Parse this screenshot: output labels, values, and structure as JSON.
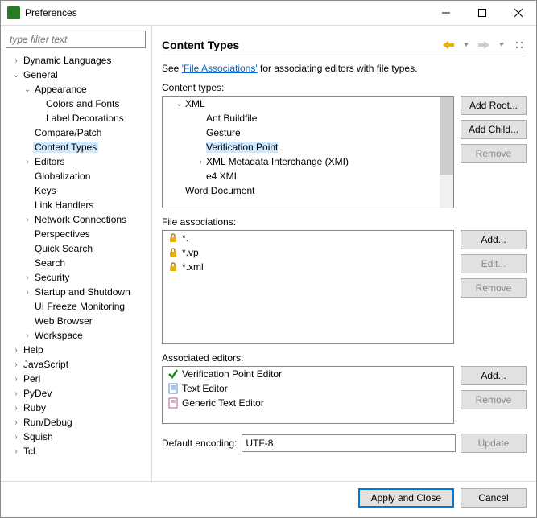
{
  "window": {
    "title": "Preferences"
  },
  "filter": {
    "placeholder": "type filter text"
  },
  "tree": [
    {
      "label": "Dynamic Languages",
      "indent": 0,
      "twisty": "›",
      "selected": false
    },
    {
      "label": "General",
      "indent": 0,
      "twisty": "⌄",
      "selected": false
    },
    {
      "label": "Appearance",
      "indent": 1,
      "twisty": "⌄",
      "selected": false
    },
    {
      "label": "Colors and Fonts",
      "indent": 2,
      "twisty": "",
      "selected": false
    },
    {
      "label": "Label Decorations",
      "indent": 2,
      "twisty": "",
      "selected": false
    },
    {
      "label": "Compare/Patch",
      "indent": 1,
      "twisty": "",
      "selected": false
    },
    {
      "label": "Content Types",
      "indent": 1,
      "twisty": "",
      "selected": true
    },
    {
      "label": "Editors",
      "indent": 1,
      "twisty": "›",
      "selected": false
    },
    {
      "label": "Globalization",
      "indent": 1,
      "twisty": "",
      "selected": false
    },
    {
      "label": "Keys",
      "indent": 1,
      "twisty": "",
      "selected": false
    },
    {
      "label": "Link Handlers",
      "indent": 1,
      "twisty": "",
      "selected": false
    },
    {
      "label": "Network Connections",
      "indent": 1,
      "twisty": "›",
      "selected": false
    },
    {
      "label": "Perspectives",
      "indent": 1,
      "twisty": "",
      "selected": false
    },
    {
      "label": "Quick Search",
      "indent": 1,
      "twisty": "",
      "selected": false
    },
    {
      "label": "Search",
      "indent": 1,
      "twisty": "",
      "selected": false
    },
    {
      "label": "Security",
      "indent": 1,
      "twisty": "›",
      "selected": false
    },
    {
      "label": "Startup and Shutdown",
      "indent": 1,
      "twisty": "›",
      "selected": false
    },
    {
      "label": "UI Freeze Monitoring",
      "indent": 1,
      "twisty": "",
      "selected": false
    },
    {
      "label": "Web Browser",
      "indent": 1,
      "twisty": "",
      "selected": false
    },
    {
      "label": "Workspace",
      "indent": 1,
      "twisty": "›",
      "selected": false
    },
    {
      "label": "Help",
      "indent": 0,
      "twisty": "›",
      "selected": false
    },
    {
      "label": "JavaScript",
      "indent": 0,
      "twisty": "›",
      "selected": false
    },
    {
      "label": "Perl",
      "indent": 0,
      "twisty": "›",
      "selected": false
    },
    {
      "label": "PyDev",
      "indent": 0,
      "twisty": "›",
      "selected": false
    },
    {
      "label": "Ruby",
      "indent": 0,
      "twisty": "›",
      "selected": false
    },
    {
      "label": "Run/Debug",
      "indent": 0,
      "twisty": "›",
      "selected": false
    },
    {
      "label": "Squish",
      "indent": 0,
      "twisty": "›",
      "selected": false
    },
    {
      "label": "Tcl",
      "indent": 0,
      "twisty": "›",
      "selected": false
    }
  ],
  "page": {
    "title": "Content Types",
    "intro_pre": "See ",
    "intro_link": "'File Associations'",
    "intro_post": " for associating editors with file types.",
    "ct_label": "Content types:",
    "fa_label": "File associations:",
    "ae_label": "Associated editors:",
    "encoding_label": "Default encoding:",
    "encoding_value": "UTF-8"
  },
  "content_types": [
    {
      "label": "XML",
      "indent": 1,
      "twisty": "⌄",
      "selected": false
    },
    {
      "label": "Ant Buildfile",
      "indent": 2,
      "twisty": "",
      "selected": false
    },
    {
      "label": "Gesture",
      "indent": 2,
      "twisty": "",
      "selected": false
    },
    {
      "label": "Verification Point",
      "indent": 2,
      "twisty": "",
      "selected": true
    },
    {
      "label": "XML Metadata Interchange (XMI)",
      "indent": 2,
      "twisty": "›",
      "selected": false
    },
    {
      "label": "e4 XMI",
      "indent": 2,
      "twisty": "",
      "selected": false
    },
    {
      "label": "Word Document",
      "indent": 1,
      "twisty": "",
      "selected": false
    }
  ],
  "file_assoc": [
    {
      "pattern": "*.",
      "locked": true
    },
    {
      "pattern": "*.vp",
      "locked": true
    },
    {
      "pattern": "*.xml",
      "locked": true
    }
  ],
  "editors": [
    {
      "name": "Verification Point Editor",
      "icon": "check"
    },
    {
      "name": "Text Editor",
      "icon": "doc"
    },
    {
      "name": "Generic Text Editor",
      "icon": "doc2"
    }
  ],
  "buttons": {
    "add_root": "Add Root...",
    "add_child": "Add Child...",
    "remove": "Remove",
    "add": "Add...",
    "edit": "Edit...",
    "update": "Update",
    "apply_close": "Apply and Close",
    "cancel": "Cancel"
  }
}
